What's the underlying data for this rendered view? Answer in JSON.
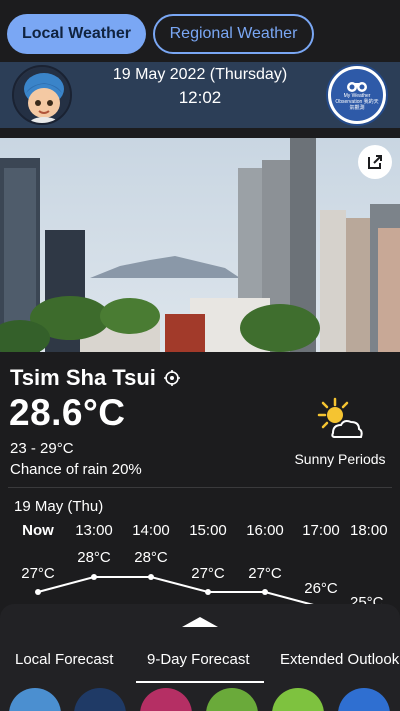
{
  "toggle": {
    "local": "Local Weather",
    "regional": "Regional Weather"
  },
  "header": {
    "date": "19 May 2022 (Thursday)",
    "time": "12:02",
    "observer_text": "My Weather Observation 我的天氣觀測"
  },
  "current": {
    "location": "Tsim Sha Tsui",
    "temperature": "28.6°C",
    "range": "23 - 29°C",
    "rain": "Chance of rain 20%",
    "condition": "Sunny Periods"
  },
  "hourly": {
    "date": "19 May (Thu)",
    "hours": [
      {
        "label": "Now",
        "temp": "27°C"
      },
      {
        "label": "13:00",
        "temp": "28°C"
      },
      {
        "label": "14:00",
        "temp": "28°C"
      },
      {
        "label": "15:00",
        "temp": "27°C"
      },
      {
        "label": "16:00",
        "temp": "27°C"
      },
      {
        "label": "17:00",
        "temp": "26°C"
      },
      {
        "label": "18:00",
        "temp": "25°C"
      }
    ]
  },
  "bottom": {
    "tabs": [
      "Local Forecast",
      "9-Day Forecast",
      "Extended Outlook"
    ],
    "active_tab": "9-Day Forecast",
    "icons": [
      "radar-icon",
      "satellite-icon",
      "weather-photo-icon",
      "world-weather-icon",
      "uv-index-icon",
      "weather-app-icon"
    ]
  },
  "colors": {
    "accent": "#7aa7f4",
    "header_bg": "#2c3e57",
    "background": "#1c1c1e"
  }
}
